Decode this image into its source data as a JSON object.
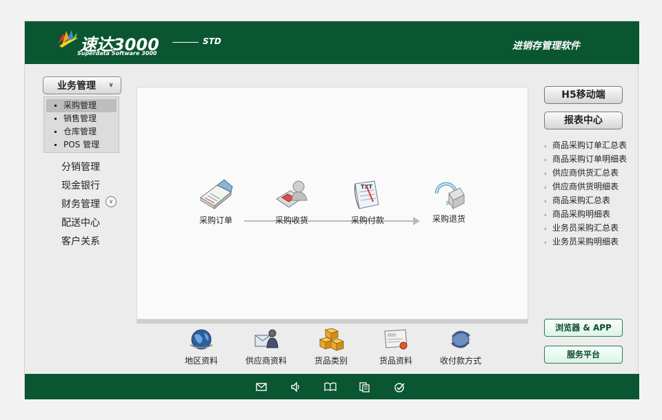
{
  "header": {
    "brand_title": "速达3000",
    "brand_edition": "STD",
    "brand_subtitle": "Superdata Software 3000",
    "slogan": "进销存管理软件"
  },
  "left_nav": {
    "group_label": "业务管理",
    "submenu": [
      {
        "label": "采购管理",
        "active": true
      },
      {
        "label": "销售管理"
      },
      {
        "label": "仓库管理"
      },
      {
        "label": "POS 管理"
      }
    ],
    "items": [
      "分销管理",
      "现金银行",
      "财务管理",
      "配送中心",
      "客户关系"
    ]
  },
  "flow": {
    "nodes": [
      {
        "label": "采购订单",
        "icon": "open-book-icon"
      },
      {
        "label": "采购收货",
        "icon": "receive-goods-icon"
      },
      {
        "label": "采购付款",
        "icon": "txt-document-icon"
      },
      {
        "label": "采购退货",
        "icon": "return-cycle-icon"
      }
    ]
  },
  "bottom_shortcuts": [
    {
      "label": "地区资料",
      "icon": "globe-icon"
    },
    {
      "label": "供应商资料",
      "icon": "supplier-icon"
    },
    {
      "label": "货品类别",
      "icon": "boxes-icon"
    },
    {
      "label": "货品资料",
      "icon": "product-card-icon"
    },
    {
      "label": "收付款方式",
      "icon": "payment-method-icon"
    }
  ],
  "right_panel": {
    "h5_button": "H5移动端",
    "report_button": "报表中心",
    "reports": [
      "商品采购订单汇总表",
      "商品采购订单明细表",
      "供应商供货汇总表",
      "供应商供货明细表",
      "商品采购汇总表",
      "商品采购明细表",
      "业务员采购汇总表",
      "业务员采购明细表"
    ],
    "browser_app_button": "浏览器 & APP",
    "service_button": "服务平台"
  },
  "footer_icons": [
    "mail-icon",
    "speaker-icon",
    "book-icon",
    "documents-icon",
    "check-circle-icon"
  ],
  "colors": {
    "brand_green": "#0b5632",
    "panel_gray": "#ececec"
  }
}
